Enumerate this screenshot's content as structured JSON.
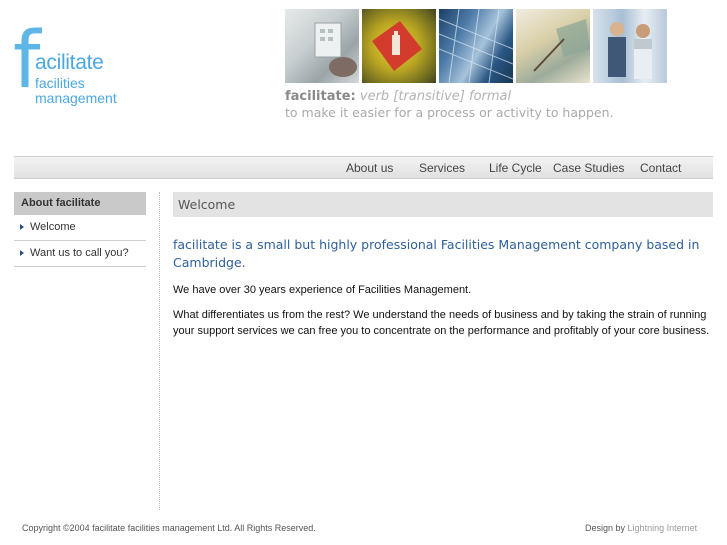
{
  "logo": {
    "letter": "f",
    "word": "acilitate",
    "line2": "facilities",
    "line3": "management"
  },
  "photos": [
    "keypad-photo",
    "fire-extinguisher-sign-photo",
    "glass-building-photo",
    "writing-hand-photo",
    "business-people-photo"
  ],
  "tagline": {
    "word": "facilitate:",
    "grammar": "verb [transitive] formal",
    "definition": "to make it easier for a process or activity to happen."
  },
  "nav": {
    "about": "About us",
    "services": "Services",
    "lifecycle": "Life Cycle",
    "case_studies": "Case Studies",
    "contact": "Contact"
  },
  "sidebar": {
    "heading": "About facilitate",
    "items": [
      {
        "label": "Welcome"
      },
      {
        "label": "Want us to call you?"
      }
    ]
  },
  "main": {
    "heading": "Welcome",
    "intro": "facilitate is a small but highly professional Facilities Management company based in Cambridge.",
    "para1": "We have over 30 years experience of Facilities Management.",
    "para2": "What differentiates us from the rest? We understand the needs of business and by taking the strain of running your support services we can free you to concentrate on the performance and profitably of your core business."
  },
  "footer": {
    "copyright": "Copyright ©2004 facilitate facilities management Ltd. All Rights Reserved.",
    "design_prefix": "Design by",
    "design_link": "Lightning Internet"
  },
  "colors": {
    "logo_blue": "#5db6e6",
    "intro_blue": "#2e5f9b",
    "sidebar_heading_bg": "#c9c9c9"
  }
}
